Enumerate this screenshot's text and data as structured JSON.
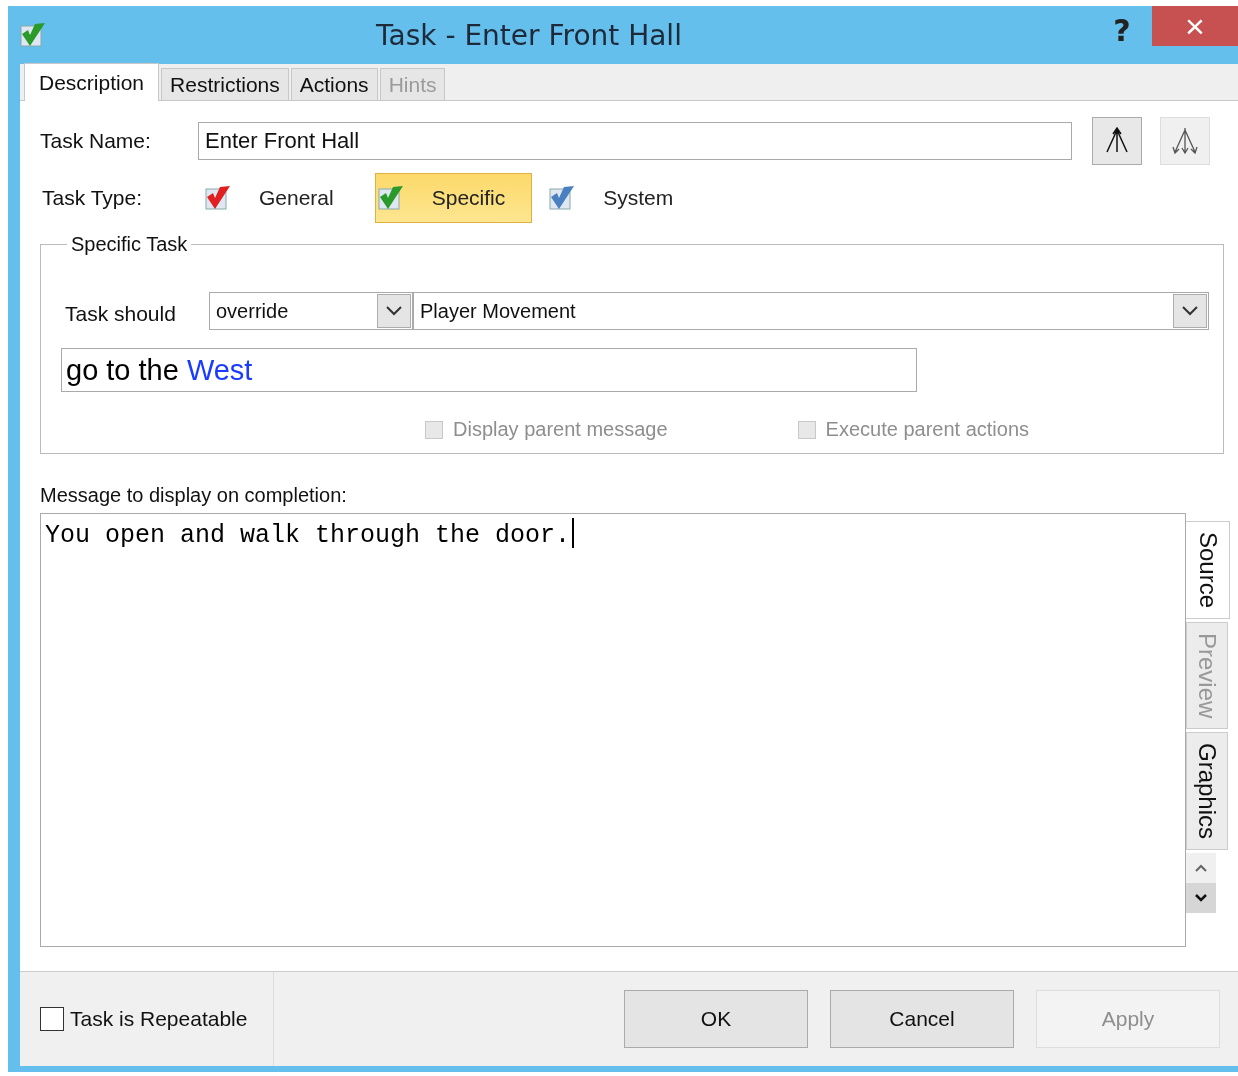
{
  "window": {
    "title": "Task - Enter Front Hall",
    "help": "?",
    "close": "×"
  },
  "tabs": [
    {
      "label": "Description",
      "selected": true,
      "disabled": false
    },
    {
      "label": "Restrictions",
      "selected": false,
      "disabled": false
    },
    {
      "label": "Actions",
      "selected": false,
      "disabled": false
    },
    {
      "label": "Hints",
      "selected": false,
      "disabled": true
    }
  ],
  "task_name": {
    "label": "Task Name:",
    "value": "Enter Front Hall"
  },
  "task_type": {
    "label": "Task Type:",
    "options": [
      {
        "label": "General",
        "color": "#e02020",
        "selected": false
      },
      {
        "label": "Specific",
        "color": "#2a9a2a",
        "selected": true
      },
      {
        "label": "System",
        "color": "#4a7fc0",
        "selected": false
      }
    ]
  },
  "specific_task": {
    "legend": "Specific Task",
    "label": "Task should",
    "mode": "override",
    "target": "Player Movement",
    "expression": [
      {
        "text": "go to the",
        "kind": "plain"
      },
      {
        "text": "West",
        "kind": "reference"
      }
    ],
    "options": [
      {
        "label": "Display parent message",
        "checked": false,
        "disabled": true
      },
      {
        "label": "Execute parent actions",
        "checked": false,
        "disabled": true
      }
    ]
  },
  "message": {
    "label": "Message to display on completion:",
    "value": "You open and walk through the door.",
    "view_tabs": [
      {
        "label": "Source",
        "selected": true,
        "disabled": false
      },
      {
        "label": "Preview",
        "selected": false,
        "disabled": true
      },
      {
        "label": "Graphics",
        "selected": false,
        "disabled": false
      }
    ]
  },
  "repeatable": {
    "label": "Task is Repeatable",
    "checked": false
  },
  "buttons": [
    {
      "label": "OK",
      "disabled": false
    },
    {
      "label": "Cancel",
      "disabled": false
    },
    {
      "label": "Apply",
      "disabled": true
    }
  ]
}
